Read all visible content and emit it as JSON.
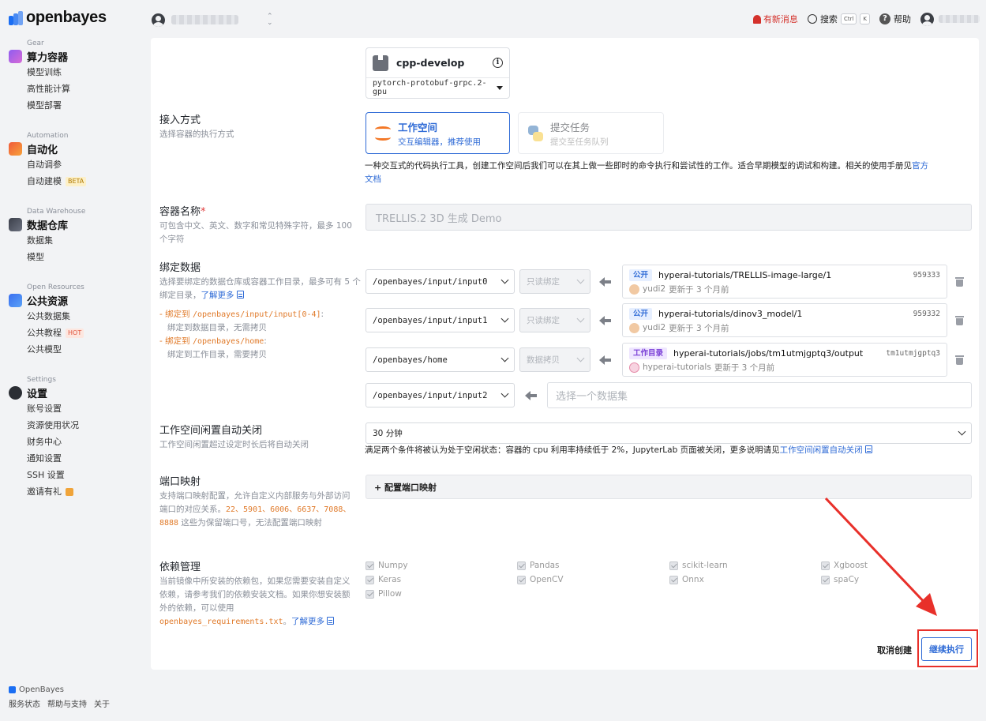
{
  "brand": {
    "name": "openbayes"
  },
  "topbar": {
    "notice": "有新消息",
    "search": "搜索",
    "kbd_ctrl": "Ctrl",
    "kbd_k": "K",
    "help": "帮助"
  },
  "sidebar": {
    "groups": [
      {
        "category": "Gear",
        "title": "算力容器",
        "items": [
          "模型训练",
          "高性能计算",
          "模型部署"
        ]
      },
      {
        "category": "Automation",
        "title": "自动化",
        "items": [
          "自动调参",
          "自动建模"
        ],
        "badge": "BETA"
      },
      {
        "category": "Data Warehouse",
        "title": "数据仓库",
        "items": [
          "数据集",
          "模型"
        ]
      },
      {
        "category": "Open Resources",
        "title": "公共资源",
        "items": [
          "公共数据集",
          "公共教程",
          "公共模型"
        ],
        "badge": "HOT"
      },
      {
        "category": "Settings",
        "title": "设置",
        "items": [
          "账号设置",
          "资源使用状况",
          "财务中心",
          "通知设置",
          "SSH 设置",
          "邀请有礼"
        ]
      }
    ],
    "footer": {
      "brand": "OpenBayes",
      "links": [
        "服务状态",
        "帮助与支持",
        "关于"
      ]
    }
  },
  "image": {
    "name": "cpp-develop",
    "tag": "pytorch-protobuf-grpc.2-gpu"
  },
  "access": {
    "label": "接入方式",
    "desc": "选择容器的执行方式",
    "modes": [
      {
        "title": "工作空间",
        "subtitle": "交互编辑器，推荐使用"
      },
      {
        "title": "提交任务",
        "subtitle": "提交至任务队列"
      }
    ],
    "note": "一种交互式的代码执行工具，创建工作空间后我们可以在其上做一些即时的命令执行和尝试性的工作。适合早期模型的调试和构建。相关的使用手册见",
    "note_link1": "官方",
    "note_link2": "文档"
  },
  "container_name": {
    "label": "容器名称",
    "required": "*",
    "desc": "可包含中文、英文、数字和常见特殊字符，最多 100 个字符",
    "value": "TRELLIS.2 3D 生成 Demo"
  },
  "bind": {
    "label": "绑定数据",
    "desc_line1": "选择要绑定的数据仓库或容器工作目录，最多可有 5 个绑定目录，",
    "learn_more": "了解更多",
    "rule1_prefix": "- 绑定到 ",
    "rule1_path": "/openbayes/input/input[0-4]",
    "rule1_suffix": ":",
    "rule1_desc": "绑定到数据目录，无需拷贝",
    "rule2_prefix": "- 绑定到 ",
    "rule2_path": "/openbayes/home",
    "rule2_suffix": ":",
    "rule2_desc": "绑定到工作目录，需要拷贝",
    "rows": [
      {
        "path": "/openbayes/input/input0",
        "mode": "只读绑定",
        "tag": "公开",
        "dataset": "hyperai-tutorials/TRELLIS-image-large/1",
        "id": "959333",
        "user": "yudi2",
        "updated": "更新于 3 个月前"
      },
      {
        "path": "/openbayes/input/input1",
        "mode": "只读绑定",
        "tag": "公开",
        "dataset": "hyperai-tutorials/dinov3_model/1",
        "id": "959332",
        "user": "yudi2",
        "updated": "更新于 3 个月前"
      },
      {
        "path": "/openbayes/home",
        "mode": "数据拷贝",
        "tag": "工作目录",
        "dataset": "hyperai-tutorials/jobs/tm1utmjgptq3/output",
        "id": "tm1utmjgptq3",
        "user": "hyperai-tutorials",
        "updated": "更新于 3 个月前"
      },
      {
        "path": "/openbayes/input/input2",
        "placeholder": "选择一个数据集"
      }
    ]
  },
  "idle": {
    "label": "工作空间闲置自动关闭",
    "desc": "工作空间闲置超过设定时长后将自动关闭",
    "value": "30 分钟",
    "note": "满足两个条件将被认为处于空闲状态：容器的 cpu 利用率持续低于 2%，JupyterLab 页面被关闭，更多说明请见",
    "note_link": "工作空间闲置自动关闭"
  },
  "port": {
    "label": "端口映射",
    "desc_a": "支持端口映射配置，允许自定义内部服务与外部访问端口的对应关系。",
    "desc_ports": "22、5901、6006、6637、7088、8888",
    "desc_b": " 这些为保留端口号，无法配置端口映射",
    "button": "+ 配置端口映射"
  },
  "deps": {
    "label": "依赖管理",
    "desc": "当前镜像中所安装的依赖包，如果您需要安装自定义依赖，请参考我们的依赖安装文档。如果你想安装额外的依赖，可以使用",
    "desc_file": "openbayes_requirements.txt",
    "desc_end": "。",
    "learn_more": "了解更多",
    "items": [
      "Numpy",
      "Pandas",
      "scikit-learn",
      "Xgboost",
      "Keras",
      "OpenCV",
      "Onnx",
      "spaCy",
      "Pillow"
    ]
  },
  "actions": {
    "cancel": "取消创建",
    "submit": "继续执行"
  },
  "colors": {
    "primary": "#2f6bd6",
    "danger": "#e03c3c",
    "annotation": "#e8302a"
  }
}
